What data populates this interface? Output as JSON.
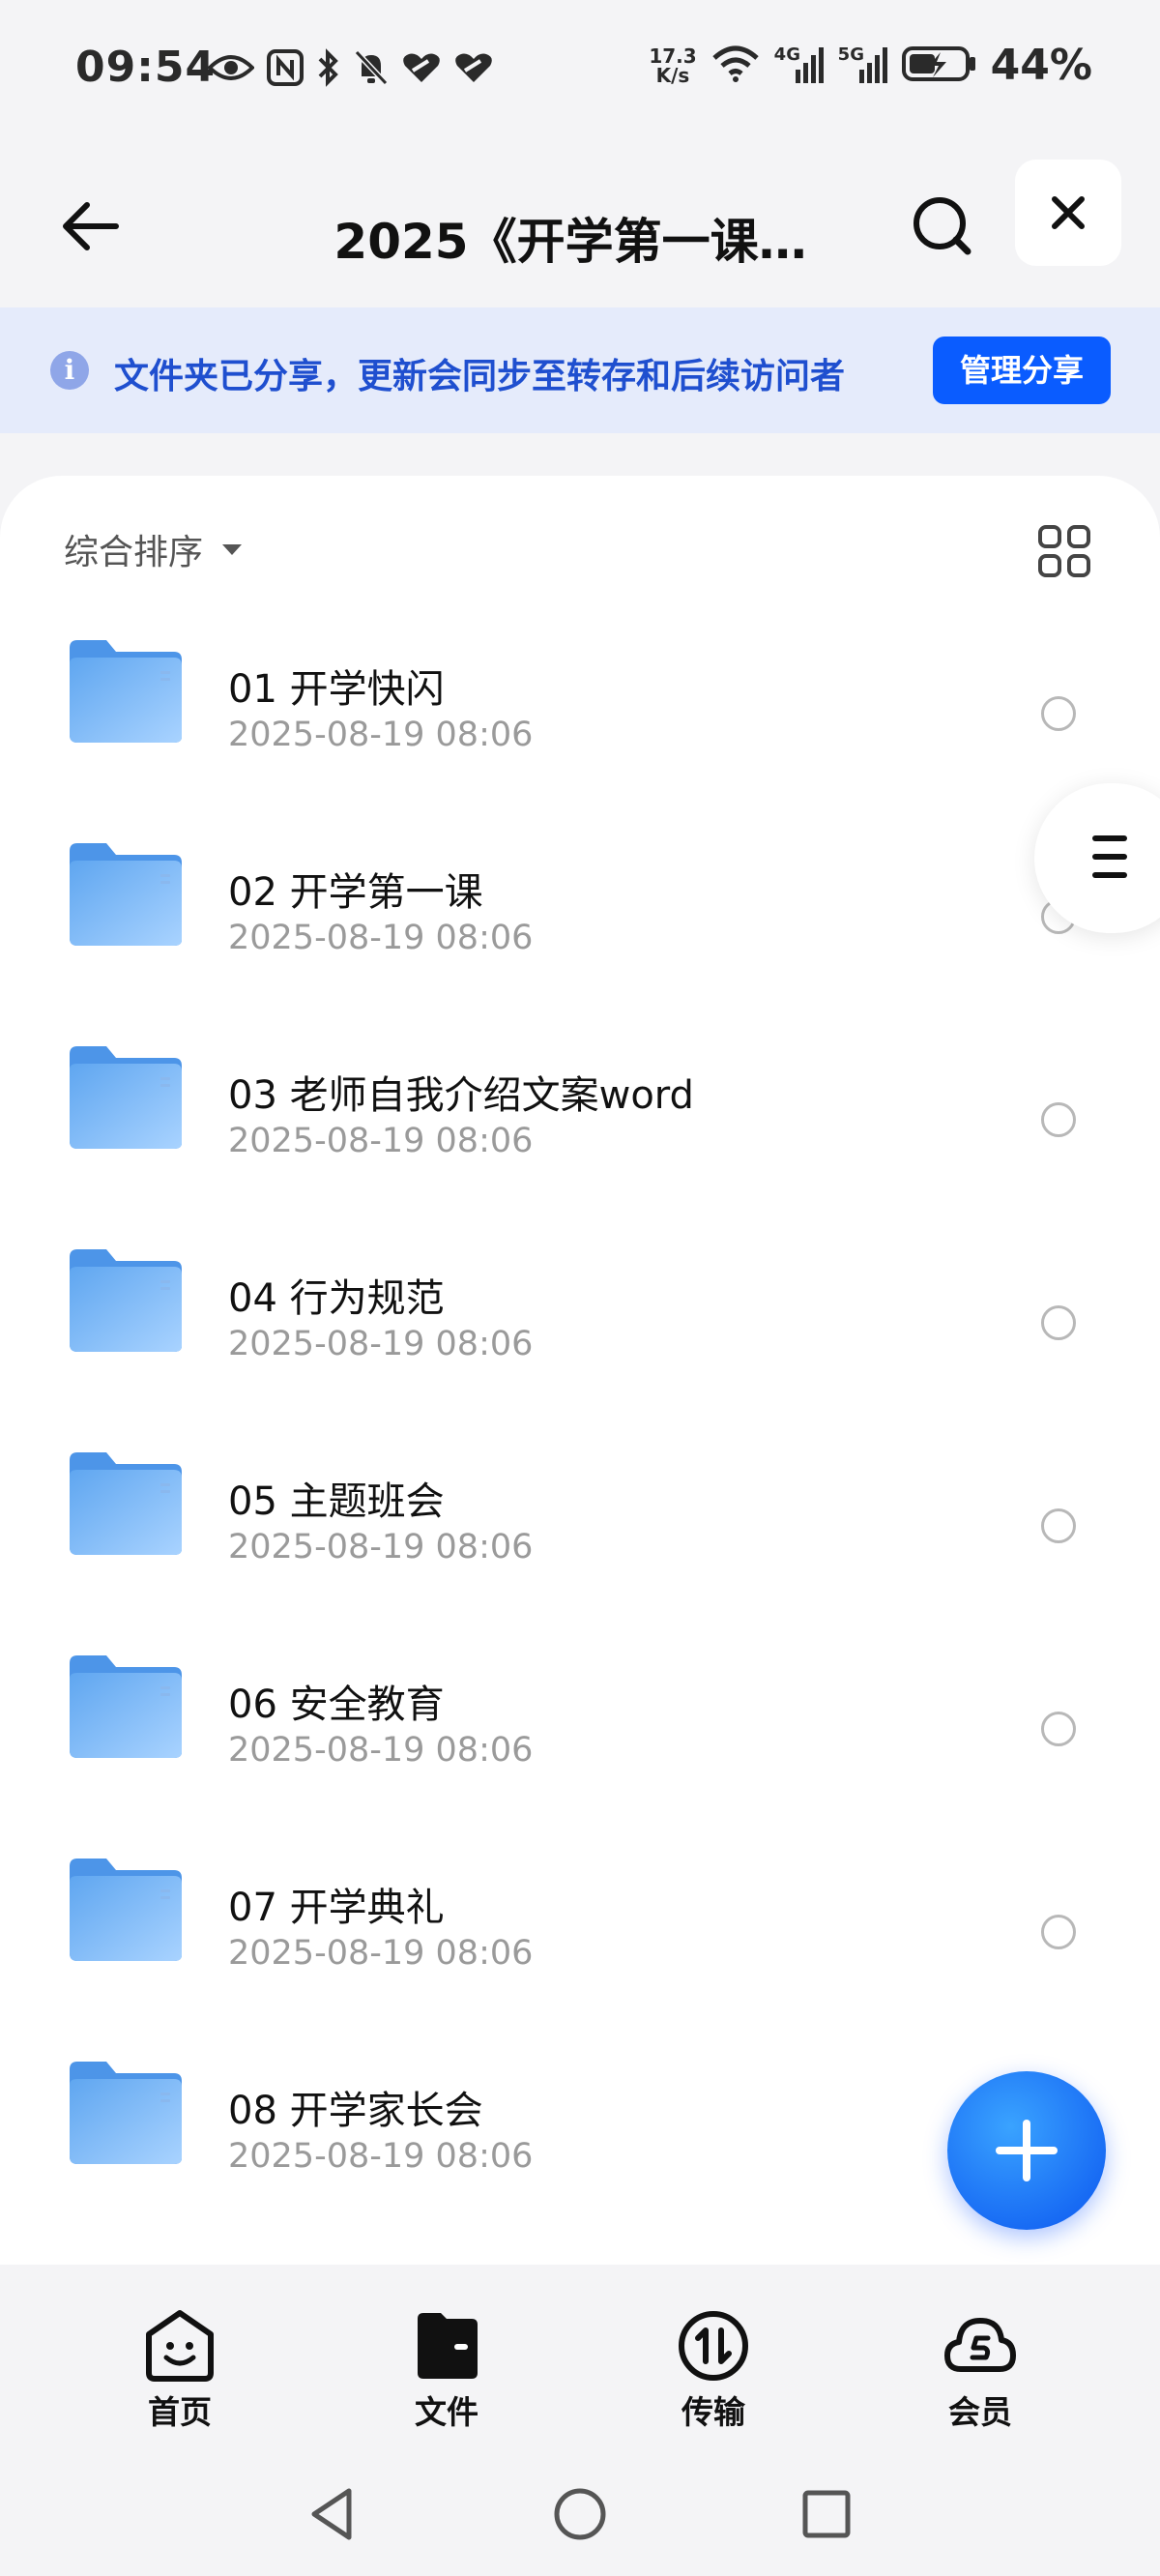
{
  "status_bar": {
    "time": "09:54",
    "net_speed_value": "17.3",
    "net_speed_unit": "K/s",
    "signal_1_label": "4G",
    "signal_2_label": "5G",
    "battery": "44%"
  },
  "header": {
    "title": "2025《开学第一课…",
    "icons": [
      "back-arrow-icon",
      "search-icon",
      "close-icon"
    ]
  },
  "share_banner": {
    "message": "文件夹已分享，更新会同步至转存和后续访问者",
    "button_label": "管理分享"
  },
  "sort": {
    "label": "综合排序"
  },
  "files": [
    {
      "name": "01 开学快闪",
      "date": "2025-08-19 08:06"
    },
    {
      "name": "02 开学第一课",
      "date": "2025-08-19 08:06"
    },
    {
      "name": "03 老师自我介绍文案word",
      "date": "2025-08-19 08:06"
    },
    {
      "name": "04 行为规范",
      "date": "2025-08-19 08:06"
    },
    {
      "name": "05 主题班会",
      "date": "2025-08-19 08:06"
    },
    {
      "name": "06 安全教育",
      "date": "2025-08-19 08:06"
    },
    {
      "name": "07 开学典礼",
      "date": "2025-08-19 08:06"
    },
    {
      "name": "08 开学家长会",
      "date": "2025-08-19 08:06"
    }
  ],
  "bottom_nav": {
    "items": [
      {
        "label": "首页",
        "icon": "home-smile-icon"
      },
      {
        "label": "文件",
        "icon": "files-folder-icon"
      },
      {
        "label": "传输",
        "icon": "transfer-icon"
      },
      {
        "label": "会员",
        "icon": "member-cloud-icon"
      }
    ],
    "active": "文件"
  },
  "colors": {
    "accent": "#0a5cff",
    "banner_bg": "#e5ebfb",
    "banner_text": "#1f4fcf",
    "folder": "#7db8f5"
  }
}
